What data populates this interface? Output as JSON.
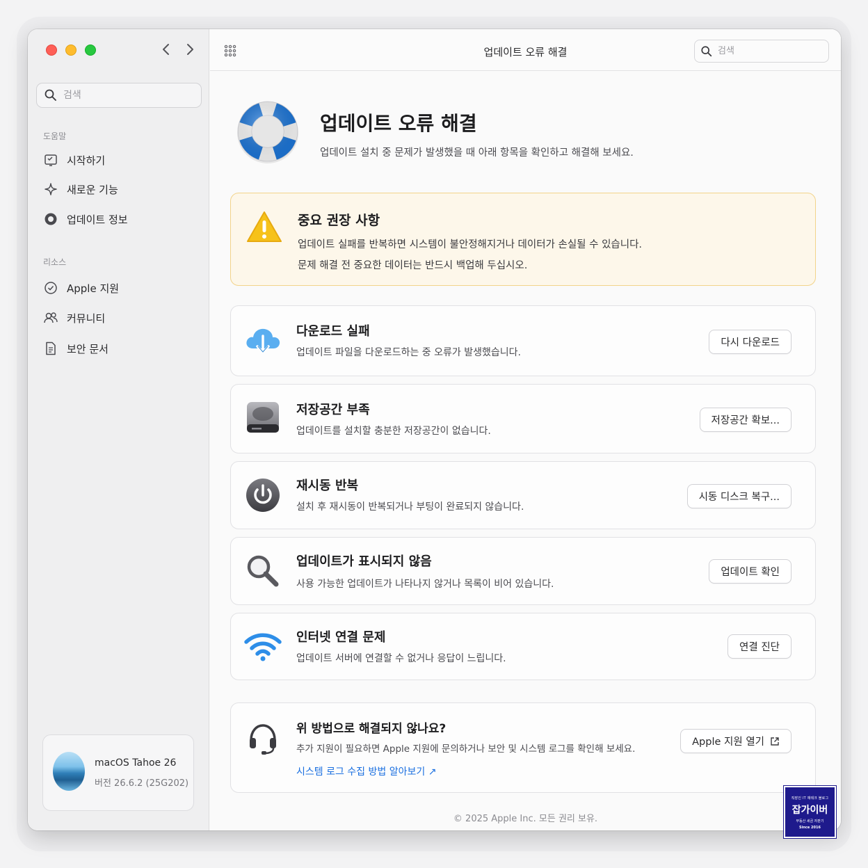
{
  "window": {
    "title": "업데이트 오류 해결"
  },
  "sidebar": {
    "search_placeholder": "검색",
    "sections": [
      {
        "header": "도움말",
        "items": [
          {
            "label": "시작하기",
            "icon": "checklist-icon"
          },
          {
            "label": "새로운 기능",
            "icon": "sparkle-icon"
          },
          {
            "label": "업데이트 정보",
            "icon": "info-circle-icon"
          }
        ]
      },
      {
        "header": "리소스",
        "items": [
          {
            "label": "Apple 지원",
            "icon": "support-check-icon"
          },
          {
            "label": "커뮤니티",
            "icon": "people-icon"
          },
          {
            "label": "보안 문서",
            "icon": "document-icon"
          }
        ]
      }
    ],
    "os_card": {
      "name": "macOS Tahoe 26",
      "version": "버전 26.6.2 (25G202)"
    }
  },
  "toolbar": {
    "search_placeholder": "검색"
  },
  "hero": {
    "title": "업데이트 오류 해결",
    "subtitle": "업데이트 설치 중 문제가 발생했을 때 아래 항목을 확인하고 해결해 보세요."
  },
  "warning": {
    "title": "중요 권장 사항",
    "line1": "업데이트 실패를 반복하면 시스템이 불안정해지거나 데이터가 손실될 수 있습니다.",
    "line2": "문제 해결 전 중요한 데이터는 반드시 백업해 두십시오."
  },
  "issues": [
    {
      "title": "다운로드 실패",
      "desc": "업데이트 파일을 다운로드하는 중 오류가 발생했습니다.",
      "button": "다시 다운로드",
      "icon": "cloud-download-icon"
    },
    {
      "title": "저장공간 부족",
      "desc": "업데이트를 설치할 충분한 저장공간이 없습니다.",
      "button": "저장공간 확보...",
      "icon": "hard-drive-icon"
    },
    {
      "title": "재시동 반복",
      "desc": "설치 후 재시동이 반복되거나 부팅이 완료되지 않습니다.",
      "button": "시동 디스크 복구...",
      "icon": "power-icon"
    },
    {
      "title": "업데이트가 표시되지 않음",
      "desc": "사용 가능한 업데이트가 나타나지 않거나 목록이 비어 있습니다.",
      "button": "업데이트 확인",
      "icon": "magnifier-icon"
    },
    {
      "title": "인터넷 연결 문제",
      "desc": "업데이트 서버에 연결할 수 없거나 응답이 느립니다.",
      "button": "연결 진단",
      "icon": "wifi-icon"
    }
  ],
  "help": {
    "title": "위 방법으로 해결되지 않나요?",
    "desc": "추가 지원이 필요하면 Apple 지원에 문의하거나 보안 및 시스템 로그를 확인해 보세요.",
    "link": "시스템 로그 수집 방법 알아보기 ↗",
    "button": "Apple 지원 열기",
    "icon": "headset-icon"
  },
  "footer": "© 2025 Apple Inc. 모든 권리 보유.",
  "badge": {
    "top": "직장인 IT 재테크 블로그",
    "name": "잡가이버",
    "sub": "부동산 세금 자판기",
    "since": "Since 2016"
  },
  "colors": {
    "accent_link": "#1a6fe0",
    "warning_bg": "#fdf7ea",
    "warning_border": "#f2d38a",
    "lifebuoy_blue": "#1f7be0"
  }
}
